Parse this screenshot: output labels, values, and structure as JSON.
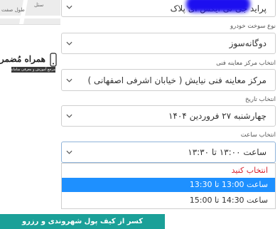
{
  "map": {
    "street_label": "طول صفت",
    "place_label": "ستل"
  },
  "vehicle": {
    "value": "پراید جی تی ایکس آی پلاک"
  },
  "fuel": {
    "label": "نوع سوخت خودرو",
    "value": "دوگانه‌سوز"
  },
  "center": {
    "label": "انتخاب مرکز معاینه فنی",
    "value": "مرکز معاینه فنی نیایش ( خیابان اشرفی اصفهانی )"
  },
  "date": {
    "label": "انتخاب تاریخ",
    "value": "چهارشنبه ۲۷ فروردین ۱۴۰۴"
  },
  "time": {
    "label": "انتخاب ساعت",
    "value": "ساعت ۱۳:۰۰ تا ۱۳:۳۰",
    "options": [
      "انتخاب کنید",
      "ساعت 13:00 تا 13:30",
      "ساعت 14:30 تا 15:00"
    ]
  },
  "logo": {
    "title": "همراه مُضمر",
    "subtitle": "مرجع آموزش و معرفی سامانه‌های دولتی و کاربردی"
  },
  "pay_button": {
    "label": "کسر از کیف پول شهروندی و رزرو"
  },
  "colors": {
    "selected_bg": "#1e90ff",
    "placeholder_text": "#d9232d",
    "button_bg": "#1ba098"
  }
}
